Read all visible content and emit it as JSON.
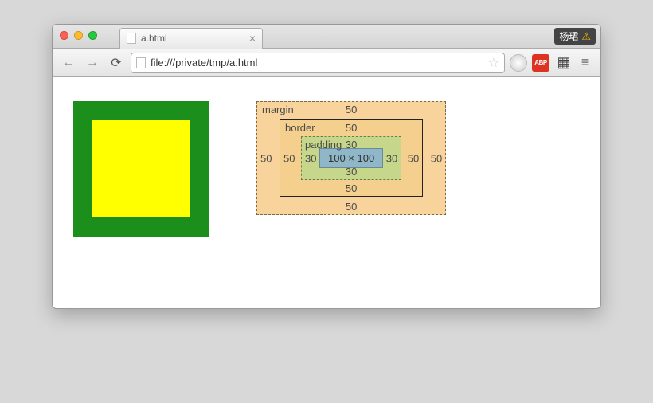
{
  "tab": {
    "title": "a.html"
  },
  "user": {
    "name": "杨珺"
  },
  "toolbar": {
    "url": "file:///private/tmp/a.html",
    "abp_label": "ABP"
  },
  "boxmodel": {
    "margin": {
      "label": "margin",
      "top": "50",
      "right": "50",
      "bottom": "50",
      "left": "50"
    },
    "border": {
      "label": "border",
      "top": "50",
      "right": "50",
      "bottom": "50",
      "left": "50"
    },
    "padding": {
      "label": "padding",
      "top": "30",
      "right": "30",
      "bottom": "30",
      "left": "30"
    },
    "content": "100 × 100"
  }
}
